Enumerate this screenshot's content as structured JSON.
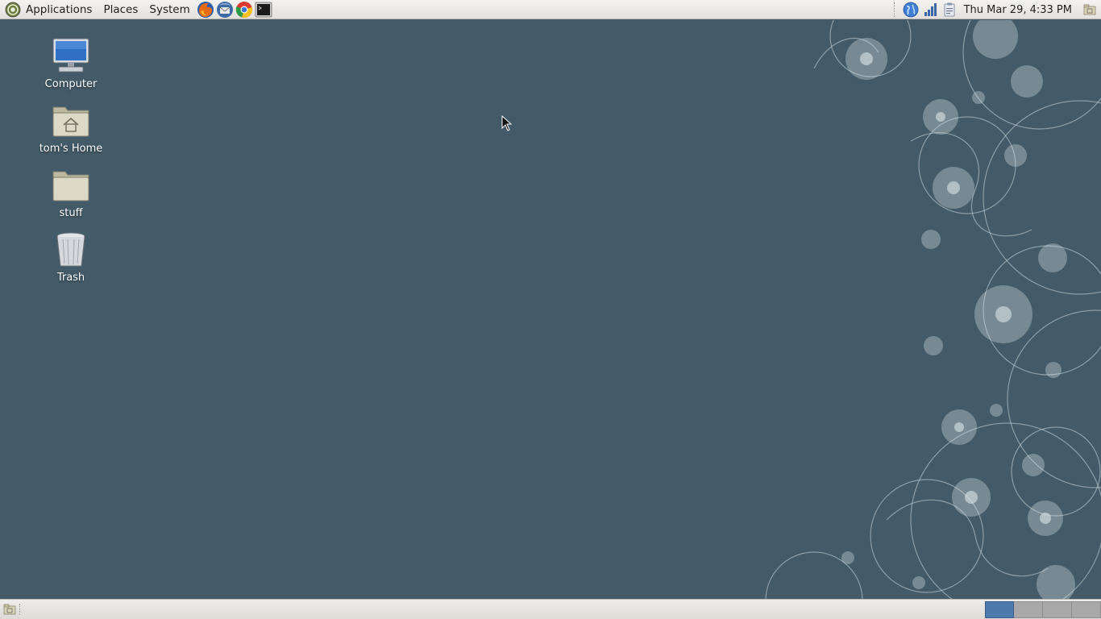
{
  "top_panel": {
    "menus": {
      "applications": "Applications",
      "places": "Places",
      "system": "System"
    },
    "launchers": [
      "firefox-icon",
      "thunderbird-icon",
      "chrome-icon",
      "terminal-icon"
    ],
    "tray_icons": [
      "network-globe-icon",
      "signal-bars-icon",
      "clipboard-notes-icon"
    ],
    "clock": "Thu Mar 29,  4:33 PM"
  },
  "desktop": {
    "background_color": "#435b68",
    "icons": [
      {
        "label": "Computer",
        "icon": "computer-icon"
      },
      {
        "label": "tom's Home",
        "icon": "home-folder-icon"
      },
      {
        "label": "stuff",
        "icon": "folder-icon"
      },
      {
        "label": "Trash",
        "icon": "trash-icon"
      }
    ]
  },
  "bottom_panel": {
    "workspaces": 4,
    "active_workspace": 1,
    "active_color": "#4e79ad"
  }
}
